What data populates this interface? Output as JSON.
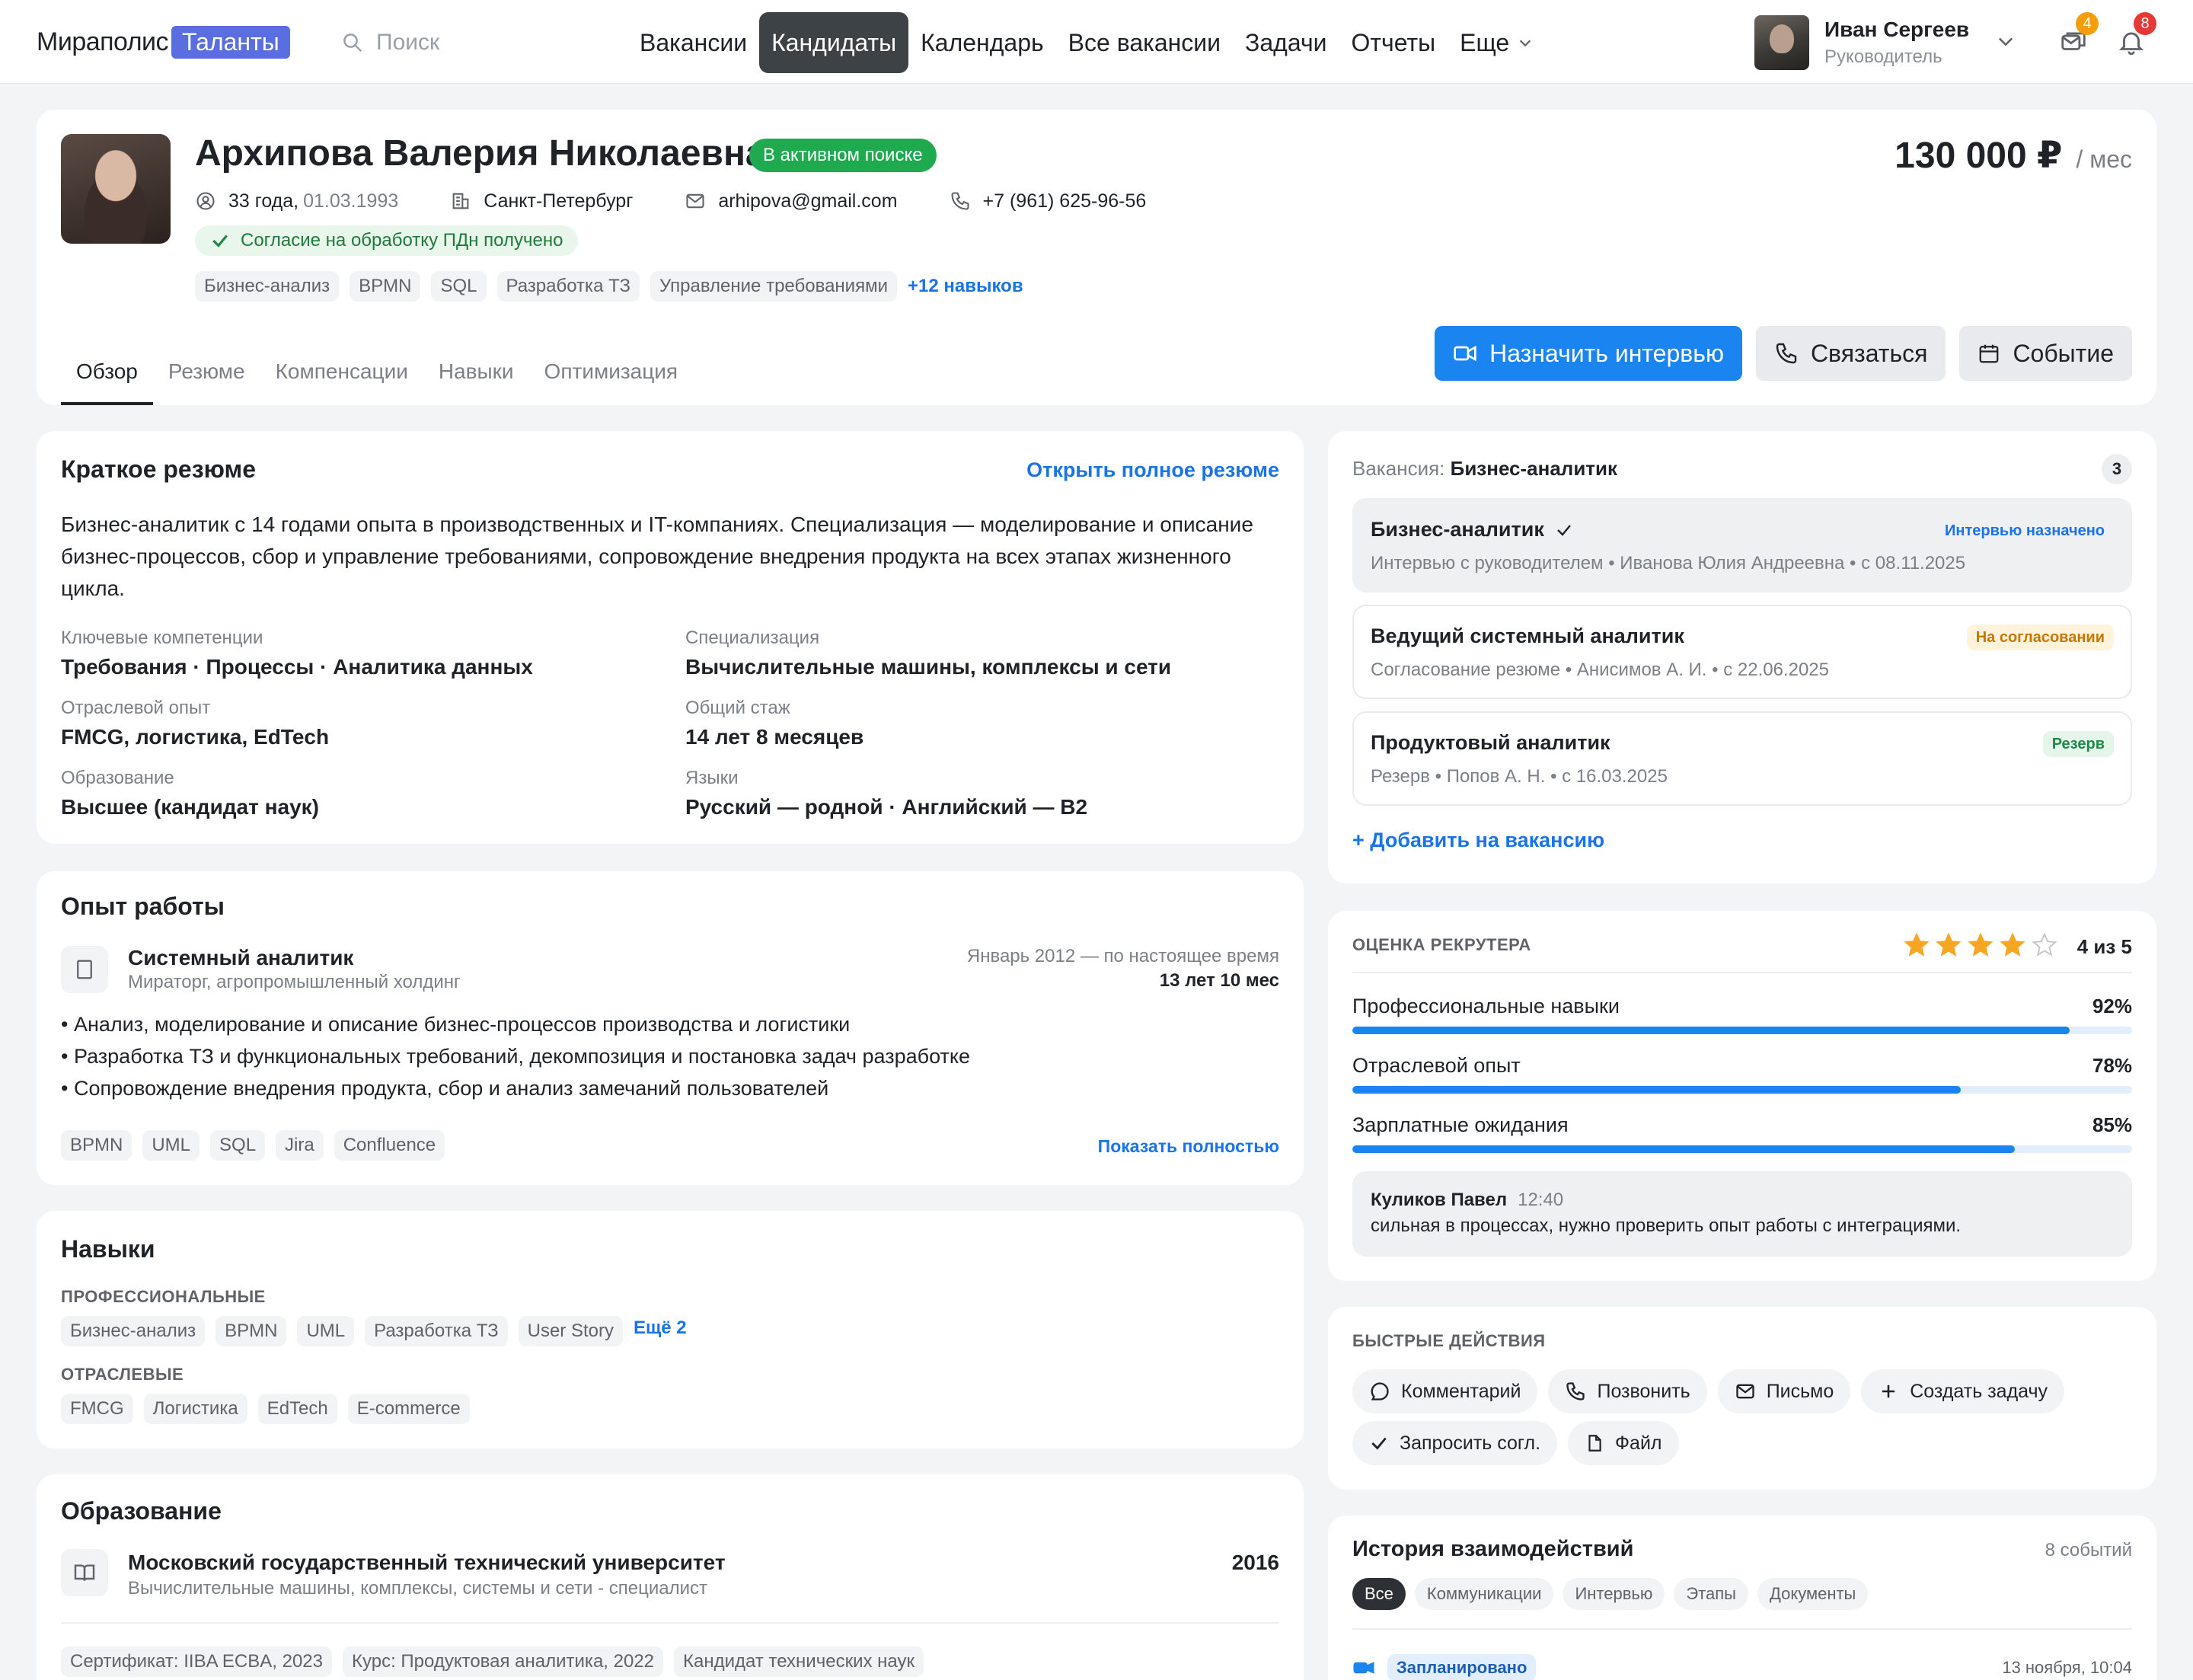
{
  "app": {
    "logo_name": "Мирапολис",
    "logo_badge": "Таланты",
    "search_placeholder": "Поиск"
  },
  "nav": {
    "items": [
      "Вакансии",
      "Кандидаты",
      "Календарь",
      "Все вакансии",
      "Задачи",
      "Отчеты"
    ],
    "active": "Кандидаты",
    "more": "Еще"
  },
  "user": {
    "name": "Иван Сергеев",
    "role": "Руководитель",
    "messages_count": "4",
    "notifications_count": "8"
  },
  "candidate": {
    "name": "Архипова Валерия Николаевна",
    "status": "В активном поиске",
    "salary": "130 000 ₽",
    "salary_period": "/ мес",
    "age": "33 года,",
    "birthdate": "01.03.1993",
    "city": "Санкт-Петербург",
    "email": "arhipova@gmail.com",
    "phone": "+7 (961) 625-96-56",
    "consent": "Согласие на обработку ПДн получено",
    "skills": [
      "Бизнес-анализ",
      "BPMN",
      "SQL",
      "Разработка ТЗ",
      "Управление требованиями"
    ],
    "more_skills": "+12 навыков"
  },
  "tabs": [
    "Обзор",
    "Резюме",
    "Компенсации",
    "Навыки",
    "Оптимизация"
  ],
  "actions": {
    "interview": "Назначить интервью",
    "contact": "Связаться",
    "event": "Событие"
  },
  "summary": {
    "title": "Краткое резюме",
    "open_link": "Открыть полное резюме",
    "text": "Бизнес-аналитик с 14 годами опыта в производственных и IT-компаниях. Специализация — моделирование и описание бизнес-процессов, сбор и управление требованиями, сопровождение внедрения продукта на всех этапах жизненного цикла.",
    "fields": [
      {
        "label": "Ключевые компетенции",
        "value": "Требования · Процессы · Аналитика данных"
      },
      {
        "label": "Специализация",
        "value": "Вычислительные машины, комплексы и сети"
      },
      {
        "label": "Отраслевой опыт",
        "value": "FMCG, логистика, EdTech"
      },
      {
        "label": "Общий стаж",
        "value": "14 лет 8 месяцев"
      },
      {
        "label": "Образование",
        "value": "Высшее (кандидат наук)"
      },
      {
        "label": "Языки",
        "value": "Русский — родной · Английский — B2"
      }
    ]
  },
  "experience": {
    "title": "Опыт работы",
    "job_title": "Системный аналитик",
    "company": "Мираторг, агропромышленный холдинг",
    "period": "Январь 2012 — по настоящее время",
    "length": "13 лет 10 мес",
    "bullets": [
      "• Анализ, моделирование и описание бизнес-процессов производства и логистики",
      "• Разработка ТЗ и функциональных требований, декомпозиция и постановка задач разработке",
      "• Сопровождение внедрения продукта, сбор и анализ замечаний пользователей"
    ],
    "tags": [
      "BPMN",
      "UML",
      "SQL",
      "Jira",
      "Confluence"
    ],
    "show_more": "Показать полностью"
  },
  "skills": {
    "title": "Навыки",
    "professional_caption": "ПРОФЕССИОНАЛЬНЫЕ",
    "professional": [
      "Бизнес-анализ",
      "BPMN",
      "UML",
      "Разработка ТЗ",
      "User Story"
    ],
    "professional_more": "Ещё 2",
    "industry_caption": "ОТРАСЛЕВЫЕ",
    "industry": [
      "FMCG",
      "Логистика",
      "EdTech",
      "E-commerce"
    ]
  },
  "education": {
    "title": "Образование",
    "university": "Московский государственный технический университет",
    "faculty": "Вычислительные машины, комплексы, системы и сети - специалист",
    "year": "2016",
    "certificates": [
      "Сертификат: IIBA ECBA, 2023",
      "Курс: Продуктовая аналитика, 2022",
      "Кандидат технических наук"
    ]
  },
  "vacancies": {
    "label": "Вакансия:",
    "current": "Бизнес-аналитик",
    "count": "3",
    "items": [
      {
        "title": "Бизнес-аналитик",
        "status": "Интервью назначено",
        "sub": "Интервью с руководителем  •  Иванова Юлия Андреевна  •  с 08.11.2025",
        "status_color": "#1a73e8",
        "status_bg": "#e3eefc"
      },
      {
        "title": "Ведущий системный аналитик",
        "status": "На согласовании",
        "sub": "Согласование резюме  •  Анисимов А. И.  •  с 22.06.2025",
        "status_color": "#c77700",
        "status_bg": "#fff3dc"
      },
      {
        "title": "Продуктовый аналитик",
        "status": "Резерв",
        "sub": "Резерв  •  Попов А. Н.  •  с 16.03.2025",
        "status_color": "#1f8a46",
        "status_bg": "#e6f5ea"
      }
    ],
    "add_link": "+ Добавить на вакансию"
  },
  "rating": {
    "caption": "ОЦЕНКА РЕКРУТЕРА",
    "stars": 4,
    "max_stars": 5,
    "value_text": "4 из 5",
    "bars": [
      {
        "label": "Профессиональные навыки",
        "pct_text": "92%",
        "pct": 92
      },
      {
        "label": "Отраслевой опыт",
        "pct_text": "78%",
        "pct": 78
      },
      {
        "label": "Зарплатные ожидания",
        "pct_text": "85%",
        "pct": 85
      }
    ],
    "comment_author": "Куликов Павел",
    "comment_time": "12:40",
    "comment_text": "сильная в процессах, нужно проверить опыт работы с интеграциями."
  },
  "quick_actions": {
    "caption": "БЫСТРЫЕ ДЕЙСТВИЯ",
    "items": [
      "Комментарий",
      "Позвонить",
      "Письмо",
      "Создать задачу",
      "Запросить согл.",
      "Файл"
    ]
  },
  "history": {
    "title": "История взаимодействий",
    "count": "8 событий",
    "filters": [
      "Все",
      "Коммуникации",
      "Интервью",
      "Этапы",
      "Документы"
    ],
    "item_status": "Запланировано",
    "item_date": "13 ноября, 10:04"
  },
  "colors": {
    "accent": "#1a84f0",
    "active_status": "#1faa50",
    "logo_badge": "#5b6ee1",
    "star": "#f5a623"
  }
}
